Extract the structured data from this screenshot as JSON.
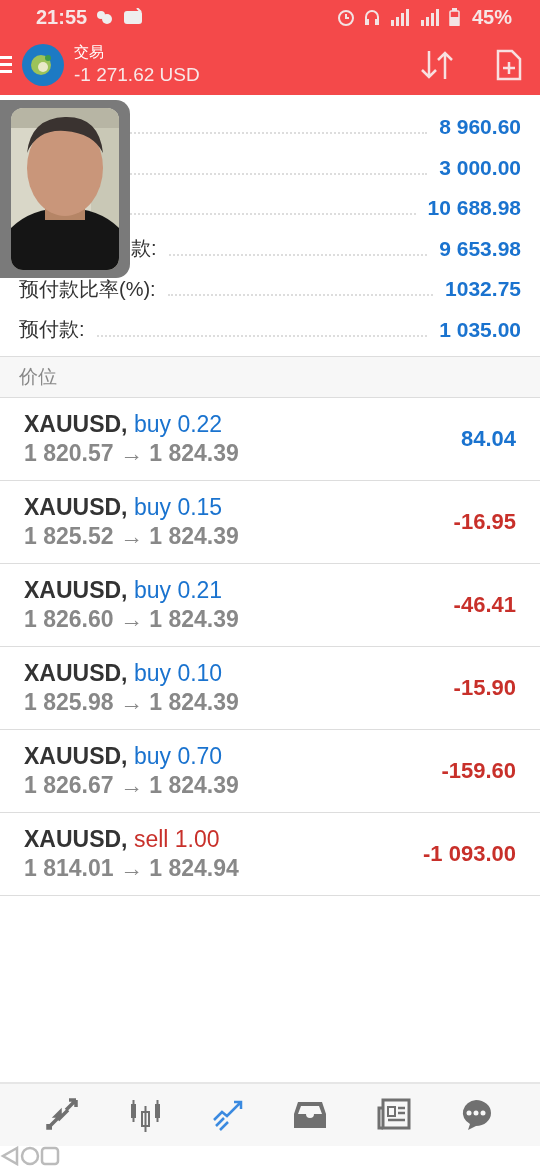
{
  "status_bar": {
    "time": "21:55",
    "battery": "45%"
  },
  "header": {
    "title": "交易",
    "balance": "-1 271.62 USD"
  },
  "summary": [
    {
      "value": "8 960.60"
    },
    {
      "value": "3 000.00"
    },
    {
      "value": "10 688.98"
    },
    {
      "label": "款:",
      "value": "9 653.98",
      "kind": "partial"
    },
    {
      "label": "预付款比率(%):",
      "value": "1032.75"
    },
    {
      "label": "预付款:",
      "value": "1 035.00"
    }
  ],
  "section": {
    "title": "价位"
  },
  "positions": [
    {
      "symbol": "XAUUSD,",
      "kind": "buy",
      "side": "buy",
      "volume": "0.22",
      "prices": "1 820.57 → 1 824.39",
      "profit": "84.04",
      "color": "#1a73cf"
    },
    {
      "symbol": "XAUUSD,",
      "kind": "buy",
      "side": "buy",
      "volume": "0.15",
      "prices": "1 825.52 → 1 824.39",
      "profit": "-16.95",
      "color": "#c8302a"
    },
    {
      "symbol": "XAUUSD,",
      "kind": "buy",
      "side": "buy",
      "volume": "0.21",
      "prices": "1 826.60 → 1 824.39",
      "profit": "-46.41",
      "color": "#c8302a"
    },
    {
      "symbol": "XAUUSD,",
      "kind": "buy",
      "side": "buy",
      "volume": "0.10",
      "prices": "1 825.98 → 1 824.39",
      "profit": "-15.90",
      "color": "#c8302a"
    },
    {
      "symbol": "XAUUSD,",
      "kind": "buy",
      "side": "buy",
      "volume": "0.70",
      "prices": "1 826.67 → 1 824.39",
      "profit": "-159.60",
      "color": "#c8302a"
    },
    {
      "symbol": "XAUUSD,",
      "kind": "sell",
      "side": "sell",
      "volume": "1.00",
      "prices": "1 814.01 → 1 824.94",
      "profit": "-1 093.00",
      "color": "#c8302a"
    }
  ],
  "bottom_nav": [
    {
      "kind": "trade",
      "selected": false
    },
    {
      "kind": "chart",
      "selected": false
    },
    {
      "kind": "trend",
      "selected": true
    },
    {
      "kind": "inbox",
      "selected": false
    },
    {
      "kind": "news",
      "selected": false
    },
    {
      "kind": "chat",
      "selected": false
    }
  ]
}
